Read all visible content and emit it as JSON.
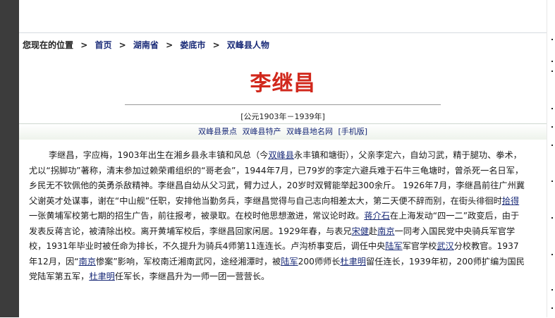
{
  "breadcrumb": {
    "prefix": "您现在的位置",
    "items": [
      "首页",
      "湖南省",
      "娄底市",
      "双峰县人物"
    ]
  },
  "title": "李继昌",
  "years": "[公元1903年－1939年]",
  "links": [
    "双峰县景点",
    "双峰县特产",
    "双峰县地名网",
    "[手机版]"
  ],
  "article": {
    "segments": [
      {
        "t": "李继昌，字应梅，1903年出生在湘乡县永丰镇和风总（今"
      },
      {
        "t": "双峰县",
        "link": true
      },
      {
        "t": "永丰镇和塘街），父亲李定六，自幼习武，精于腿功、拳术，尤以“拐脚功”著称，清末参加过赖荣甫组织的“哥老会”，1944年7月，已79岁的李定六避兵难于石牛三龟塘时，曾杀死一名日军，乡民无不钦佩他的英勇杀敌精神。李继昌自幼从父习武，臂力过人，20岁时双臂能举起300余斤。 1926年7月，李继昌前往广州冀父谢英才处谋事，谢在“中山舰”任职，安排他当勤务兵，李继昌觉得与自己志向相差太大，第二天便不辞而别，在街头徘徊时"
      },
      {
        "t": "拾得",
        "link": true
      },
      {
        "t": "一张黄埔军校第七期的招生广告，前往报考，被录取。在校时他思想激进，常议论时政。"
      },
      {
        "t": "蒋介石",
        "link": true
      },
      {
        "t": "在上海发动“四一二”政变后，由于发表反蒋言论，被清除出校。离开黄埔军校后，李继昌回家闲居。1929年春，与表兄"
      },
      {
        "t": "宋健",
        "link": true
      },
      {
        "t": "赴"
      },
      {
        "t": "南京",
        "link": true
      },
      {
        "t": "一同考入国民党中央骑兵军官学校，1931年毕业时被任命为排长，不久提升为骑兵4师第11连连长。卢沟桥事变后，调任中央"
      },
      {
        "t": "陆军",
        "link": true
      },
      {
        "t": "军官学校"
      },
      {
        "t": "武汉",
        "link": true
      },
      {
        "t": "分校教官。1937年12月，因“"
      },
      {
        "t": "南京",
        "link": true
      },
      {
        "t": "惨案”影响，军校南迁湘南武冈，途经湘潭时，被"
      },
      {
        "t": "陆军",
        "link": true
      },
      {
        "t": "200师师长"
      },
      {
        "t": "杜聿明",
        "link": true
      },
      {
        "t": "留任连长，1939年初，200师扩编为国民党陆军第五军，"
      },
      {
        "t": "杜聿明",
        "link": true
      },
      {
        "t": "任军长，李继昌升为一师一团一营营长。"
      }
    ]
  }
}
